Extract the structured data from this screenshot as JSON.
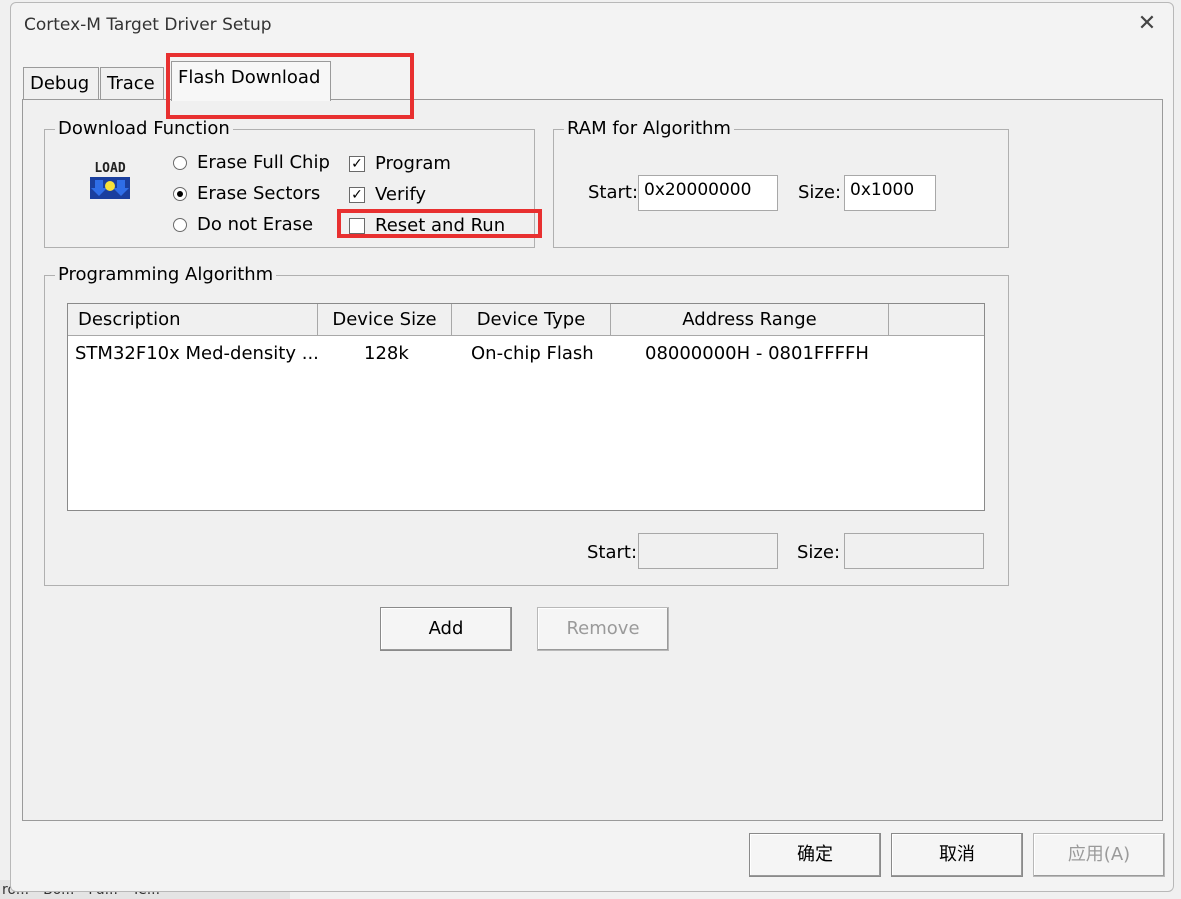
{
  "window": {
    "title": "Cortex-M Target Driver Setup",
    "close_glyph": "✕"
  },
  "tabs": [
    "Debug",
    "Trace",
    "Flash Download"
  ],
  "download_function": {
    "title": "Download Function",
    "icon_text": "LOAD",
    "radios": [
      {
        "label": "Erase Full Chip",
        "checked": false
      },
      {
        "label": "Erase Sectors",
        "checked": true
      },
      {
        "label": "Do not Erase",
        "checked": false
      }
    ],
    "checks": [
      {
        "label": "Program",
        "checked": true
      },
      {
        "label": "Verify",
        "checked": true
      },
      {
        "label": "Reset and Run",
        "checked": false
      }
    ]
  },
  "ram": {
    "title": "RAM for Algorithm",
    "start_label": "Start:",
    "start_value": "0x20000000",
    "size_label": "Size:",
    "size_value": "0x1000"
  },
  "programming": {
    "title": "Programming Algorithm",
    "columns": [
      "Description",
      "Device Size",
      "Device Type",
      "Address Range",
      ""
    ],
    "rows": [
      {
        "description": "STM32F10x Med-density ...",
        "size": "128k",
        "type": "On-chip Flash",
        "range": "08000000H - 0801FFFFH"
      }
    ],
    "start_label": "Start:",
    "start_value": "",
    "size_label": "Size:",
    "size_value": ""
  },
  "buttons": {
    "add": "Add",
    "remove": "Remove",
    "ok": "确定",
    "cancel": "取消",
    "apply": "应用(A)"
  },
  "taskbar": [
    "ro...",
    "Bo...",
    "Fu...",
    "Te..."
  ],
  "colors": {
    "highlight": "#e83030"
  }
}
